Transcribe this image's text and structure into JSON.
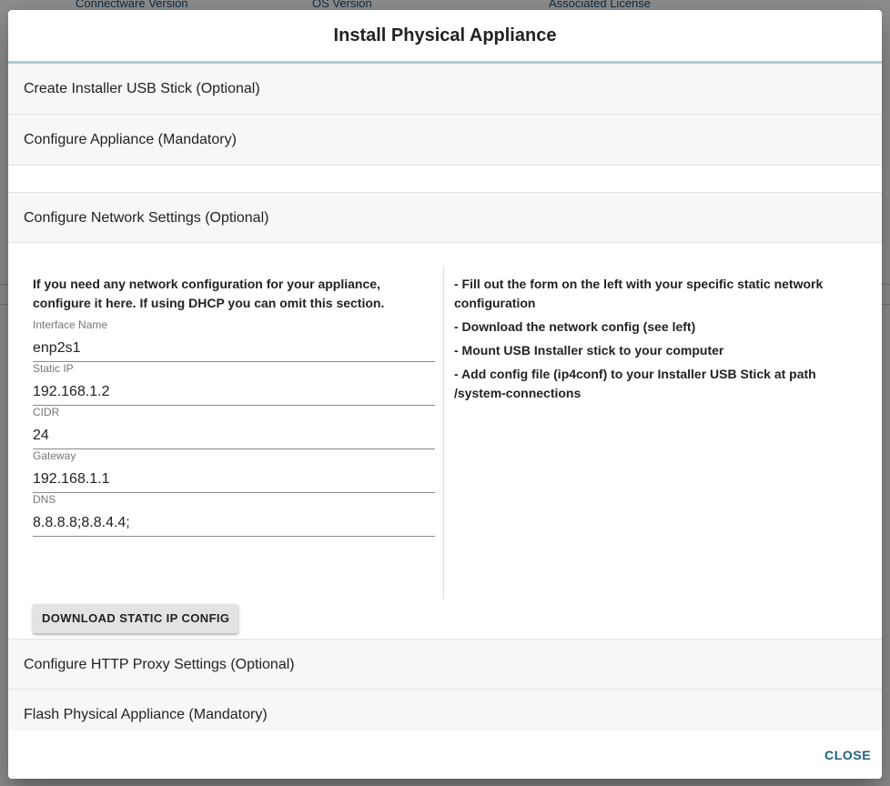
{
  "background": {
    "columns": [
      "Connectware Version",
      "OS Version",
      "Associated License"
    ]
  },
  "dialog": {
    "title": "Install Physical Appliance",
    "panels": [
      {
        "label": "Create Installer USB Stick (Optional)"
      },
      {
        "label": "Configure Appliance (Mandatory)"
      },
      {
        "label": "Configure Network Settings (Optional)"
      },
      {
        "label": "Configure HTTP Proxy Settings (Optional)"
      },
      {
        "label": "Flash Physical Appliance (Mandatory)"
      }
    ],
    "network": {
      "intro": "If you need any network configuration for your appliance, configure it here. If using DHCP you can omit this section.",
      "fields": [
        {
          "label": "Interface Name",
          "value": "enp2s1"
        },
        {
          "label": "Static IP",
          "value": "192.168.1.2"
        },
        {
          "label": "CIDR",
          "value": "24"
        },
        {
          "label": "Gateway",
          "value": "192.168.1.1"
        },
        {
          "label": "DNS",
          "value": "8.8.8.8;8.8.4.4;"
        }
      ],
      "download_button": "DOWNLOAD STATIC IP CONFIG",
      "instructions": [
        "- Fill out the form on the left with your specific static network configuration",
        "- Download the network config (see left)",
        "- Mount USB Installer stick to your computer",
        "- Add config file (ip4conf) to your Installer USB Stick at path /system-connections"
      ]
    },
    "close_label": "CLOSE"
  }
}
